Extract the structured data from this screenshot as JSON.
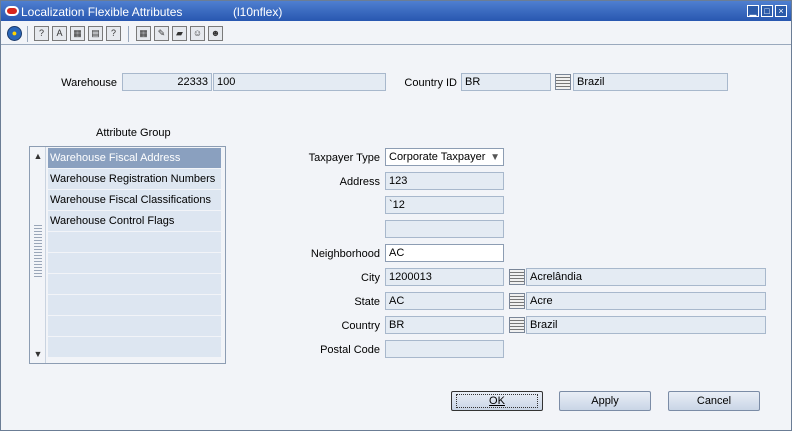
{
  "window": {
    "title": "Localization Flexible Attributes",
    "module": "(l10nflex)",
    "controls": [
      "minimize",
      "maximize",
      "close"
    ]
  },
  "toolbar": {
    "icons": [
      "globe-icon",
      "help-circle-icon",
      "spellcheck-icon",
      "calculator-icon",
      "print-icon",
      "question-icon",
      "grid-icon",
      "pencil-icon",
      "folder-open-icon",
      "user-icon",
      "users-icon"
    ]
  },
  "header": {
    "warehouse_label": "Warehouse",
    "warehouse_id": "22333",
    "warehouse_name": "100",
    "country_label": "Country ID",
    "country_id": "BR",
    "country_name": "Brazil"
  },
  "attribute_group": {
    "label": "Attribute Group",
    "items": [
      "Warehouse Fiscal Address",
      "Warehouse Registration Numbers",
      "Warehouse Fiscal Classifications",
      "Warehouse Control Flags",
      "",
      "",
      "",
      "",
      "",
      ""
    ],
    "selected_index": 0
  },
  "form": {
    "taxpayer_type_label": "Taxpayer Type",
    "taxpayer_type_value": "Corporate Taxpayer",
    "address_label": "Address",
    "address_line1": "123",
    "address_line2": "`12",
    "address_line3": "",
    "neighborhood_label": "Neighborhood",
    "neighborhood_value": "AC",
    "city_label": "City",
    "city_code": "1200013",
    "city_name": "Acrelândia",
    "state_label": "State",
    "state_code": "AC",
    "state_name": "Acre",
    "country_label": "Country",
    "country_code": "BR",
    "country_name": "Brazil",
    "postal_code_label": "Postal Code",
    "postal_code_value": ""
  },
  "buttons": {
    "ok": "OK",
    "apply": "Apply",
    "cancel": "Cancel"
  }
}
